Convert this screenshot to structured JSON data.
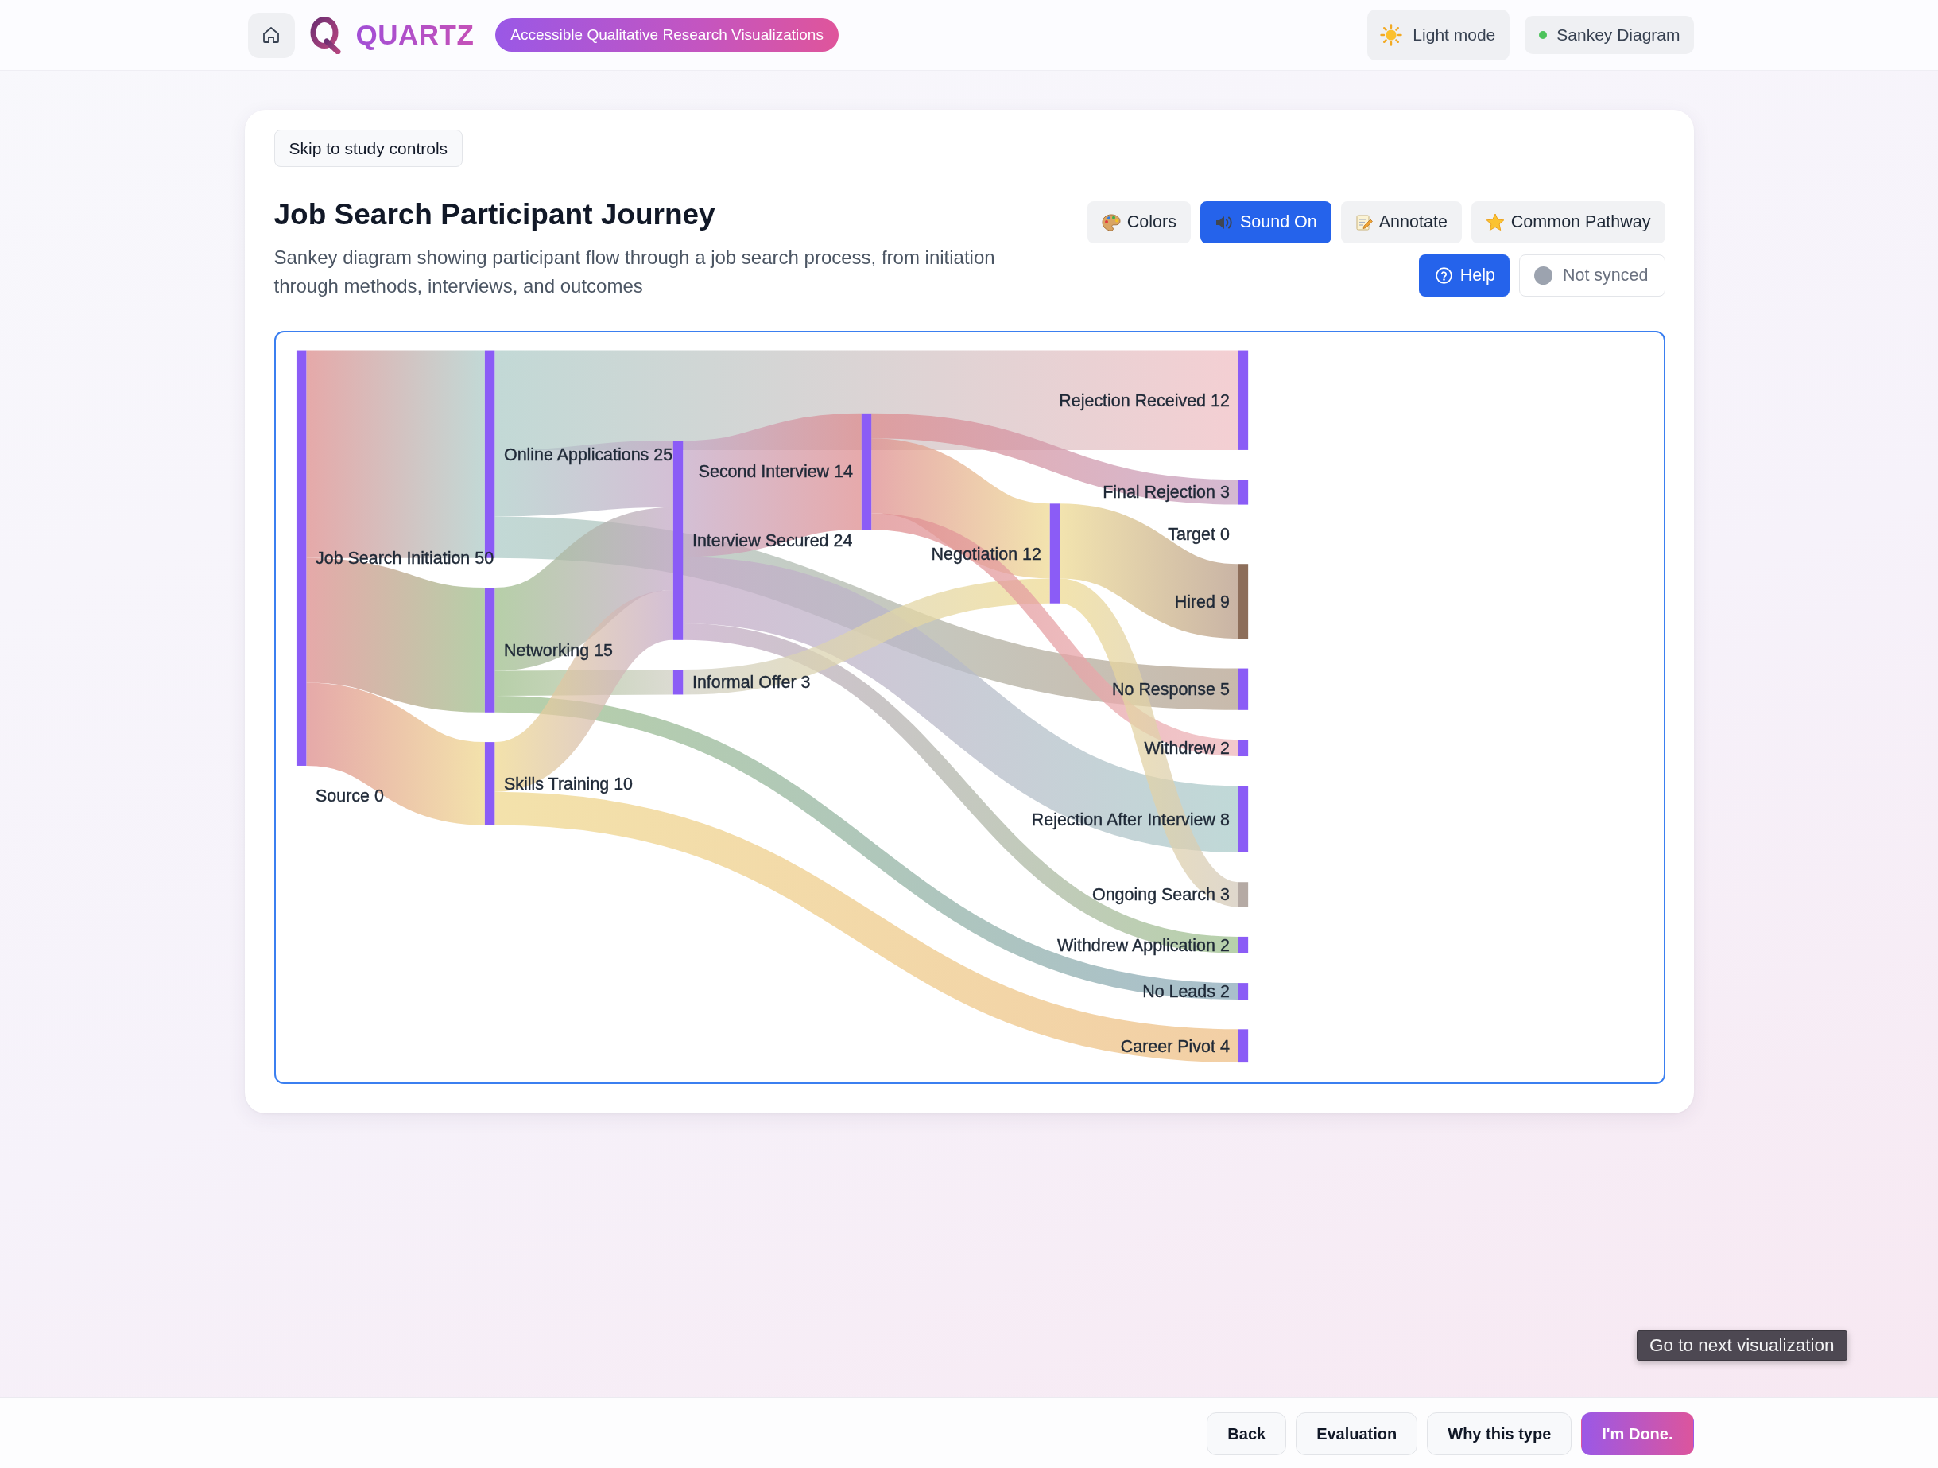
{
  "top_bar": {
    "brand": "QUARTZ",
    "tagline": "Accessible Qualitative Research Visualizations",
    "theme_toggle": {
      "label": "Light mode"
    },
    "view_indicator": {
      "label": "Sankey Diagram"
    }
  },
  "card": {
    "skip_link": "Skip to study controls",
    "title": "Job Search Participant Journey",
    "description": "Sankey diagram showing participant flow through a job search process, from initiation through methods, interviews, and outcomes",
    "toolbar": {
      "colors_button": {
        "label": "Colors"
      },
      "sound_button": {
        "label": "Sound On",
        "on": true
      },
      "annotate_button": {
        "label": "Annotate"
      },
      "pathway_button": {
        "label": "Common Pathway"
      },
      "help_button": {
        "label": "Help"
      },
      "sync_status": {
        "label": "Not synced",
        "synced": false
      }
    },
    "diagram": {
      "nodes": [
        {
          "label": "Job Search Initiation 50",
          "color": "#8b5cf6"
        },
        {
          "label": "Source 0"
        },
        {
          "label": "Online Applications 25",
          "color": "#8b5cf6"
        },
        {
          "label": "Networking 15",
          "color": "#8b5cf6"
        },
        {
          "label": "Skills Training 10",
          "color": "#8b5cf6"
        },
        {
          "label": "Second Interview 14",
          "color": "#8b5cf6"
        },
        {
          "label": "Interview Secured 24",
          "color": "#8b5cf6"
        },
        {
          "label": "Informal Offer 3",
          "color": "#8b5cf6"
        },
        {
          "label": "Negotiation 12",
          "color": "#8b5cf6"
        },
        {
          "label": "Rejection Received 12",
          "color": "#8b5cf6"
        },
        {
          "label": "Final Rejection 3",
          "color": "#8b5cf6"
        },
        {
          "label": "Target 0"
        },
        {
          "label": "Hired 9",
          "color": "#8d6e5a"
        },
        {
          "label": "No Response 5",
          "color": "#8b5cf6"
        },
        {
          "label": "Withdrew 2",
          "color": "#8b5cf6"
        },
        {
          "label": "Rejection After Interview 8",
          "color": "#8b5cf6"
        },
        {
          "label": "Ongoing Search 3",
          "color": "#b5aaa4"
        },
        {
          "label": "Withdrew Application 2",
          "color": "#8b5cf6"
        },
        {
          "label": "No Leads 2",
          "color": "#8b5cf6"
        },
        {
          "label": "Career Pivot 4",
          "color": "#8b5cf6"
        }
      ]
    }
  },
  "tooltip": {
    "text": "Go to next visualization"
  },
  "footer": {
    "buttons": [
      {
        "label": "Back",
        "kind": "secondary"
      },
      {
        "label": "Evaluation",
        "kind": "secondary"
      },
      {
        "label": "Why this type",
        "kind": "secondary"
      },
      {
        "label": "I'm Done.",
        "kind": "primary"
      }
    ]
  }
}
